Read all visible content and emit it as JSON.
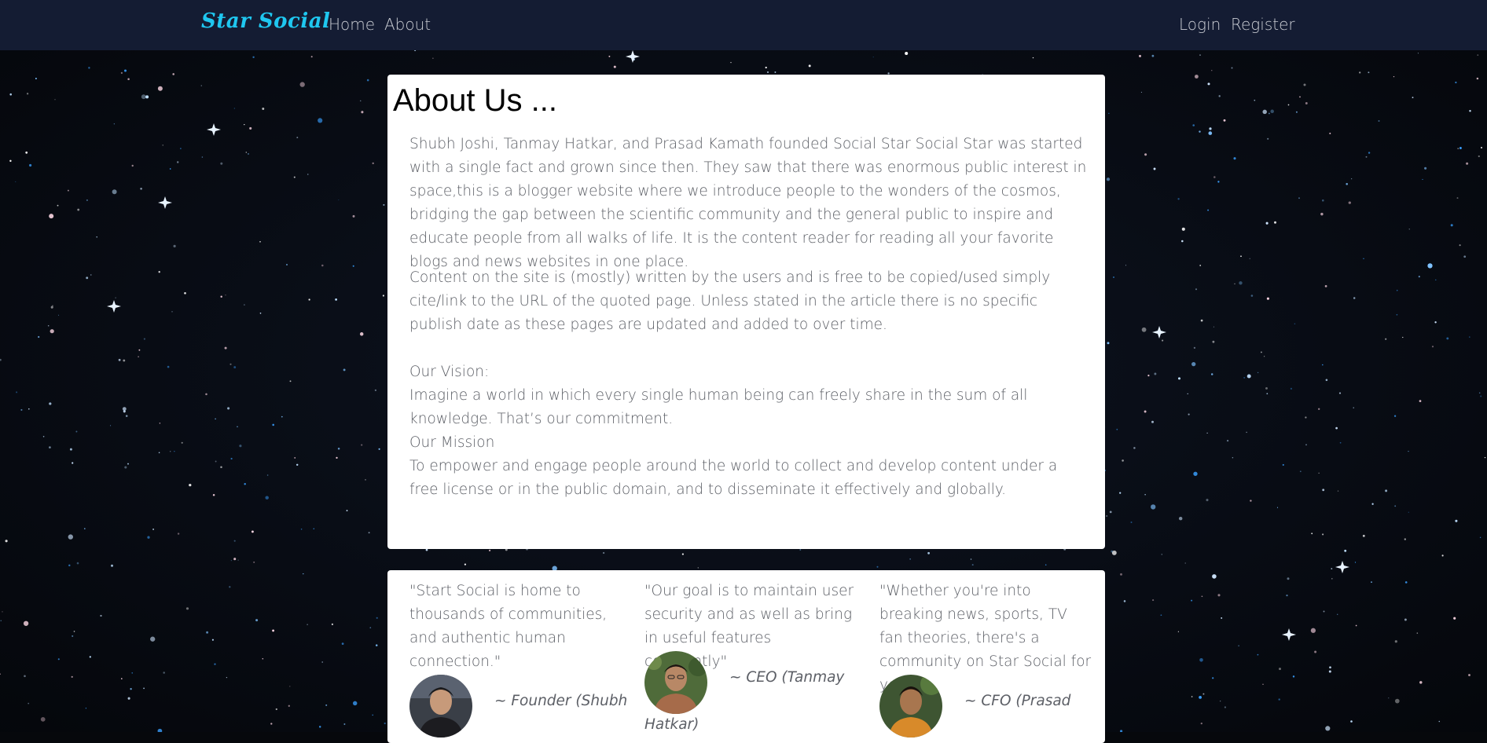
{
  "navbar": {
    "brand": "Star Social",
    "links": [
      "Home",
      "About"
    ],
    "auth_links": [
      "Login",
      "Register"
    ]
  },
  "about": {
    "title": "About Us ...",
    "paragraphs": [
      "Shubh Joshi, Tanmay Hatkar, and Prasad Kamath founded Social Star Social Star was started with a single fact and grown since then. They saw that there was enormous public interest in space,this is a blogger website where we introduce people to the wonders of the cosmos, bridging the gap between the scientific community and the general public to inspire and educate people from all walks of life. It is the content reader for reading all your favorite blogs and news websites in one place.",
      "Content on the site is (mostly) written by the users and is free to be copied/used simply cite/link to the URL of the quoted page. Unless stated in the article there is no specific publish date as these pages are updated and added to over time."
    ],
    "vision_label": "Our Vision:",
    "vision_text": "Imagine a world in which every single human being can freely share in the sum of all knowledge. That’s our commitment.",
    "mission_label": "Our Mission",
    "mission_text": "To empower and engage people around the world to collect and develop content under a free license or in the public domain, and to disseminate it effectively and globally."
  },
  "team": [
    {
      "quote": "\"Start Social is home to thousands of communities, and authentic human connection.\"",
      "role": "~ Founder (Shubh",
      "avatar": "avatar-shubh"
    },
    {
      "quote": "\"Our goal is to maintain user security and as well as bring in useful features constantly\"",
      "role": "~ CEO (Tanmay",
      "role_cont": "Hatkar)",
      "avatar": "avatar-tanmay"
    },
    {
      "quote": "\"Whether you're into breaking news, sports, TV fan theories, there's a community on Star Social for you.\"",
      "role": "~ CFO (Prasad",
      "avatar": "avatar-prasad"
    }
  ],
  "colors": {
    "navbar_bg": "#141c33",
    "brand": "#1fc7f0",
    "nav_link": "#c9ccd3",
    "card_bg": "#ffffff",
    "body_text": "#5c5f66"
  }
}
